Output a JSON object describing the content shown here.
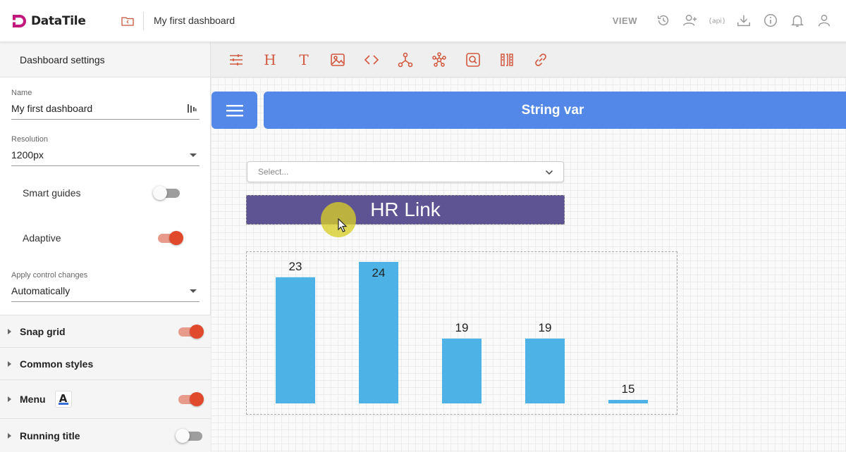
{
  "app": {
    "logo_text": "DataTile",
    "dashboard_title": "My first dashboard",
    "view_label": "VIEW",
    "top_icons": [
      "history-icon",
      "add-user-icon",
      "api-icon",
      "download-icon",
      "info-icon",
      "bell-icon",
      "user-icon"
    ],
    "api_icon_text": "{api}"
  },
  "sidebar": {
    "title": "Dashboard settings",
    "name_label": "Name",
    "name_value": "My first dashboard",
    "resolution_label": "Resolution",
    "resolution_value": "1200px",
    "smart_guides_label": "Smart guides",
    "smart_guides_on": false,
    "adaptive_label": "Adaptive",
    "adaptive_on": true,
    "apply_label": "Apply control changes",
    "apply_value": "Automatically",
    "sections": [
      {
        "label": "Snap grid",
        "on": true
      },
      {
        "label": "Common styles"
      },
      {
        "label": "Menu",
        "on": true
      },
      {
        "label": "Running title",
        "on": false
      }
    ],
    "font_icon_letter": "A"
  },
  "toolbar": {
    "tools": [
      "filters-icon",
      "heading-icon",
      "text-icon",
      "image-icon",
      "code-icon",
      "graph-icon",
      "network-icon",
      "search-widget-icon",
      "barcode-icon",
      "link-icon"
    ],
    "heading_glyph": "H",
    "text_glyph": "T"
  },
  "canvas": {
    "running_title_text": "String var",
    "select_placeholder": "Select...",
    "banner_text": "HR Link"
  },
  "colors": {
    "accent": "#e0492c",
    "title_bar": "#5387e8",
    "banner": "#5e5393",
    "bar": "#4db3e6"
  },
  "chart_data": {
    "type": "bar",
    "categories": [
      "",
      "",
      "",
      "",
      ""
    ],
    "values": [
      23,
      24,
      19,
      19,
      15
    ],
    "data_labels": [
      "23",
      "24",
      "19",
      "19",
      "15"
    ],
    "ylim": [
      15,
      24
    ],
    "grid": false,
    "legend": "none"
  }
}
